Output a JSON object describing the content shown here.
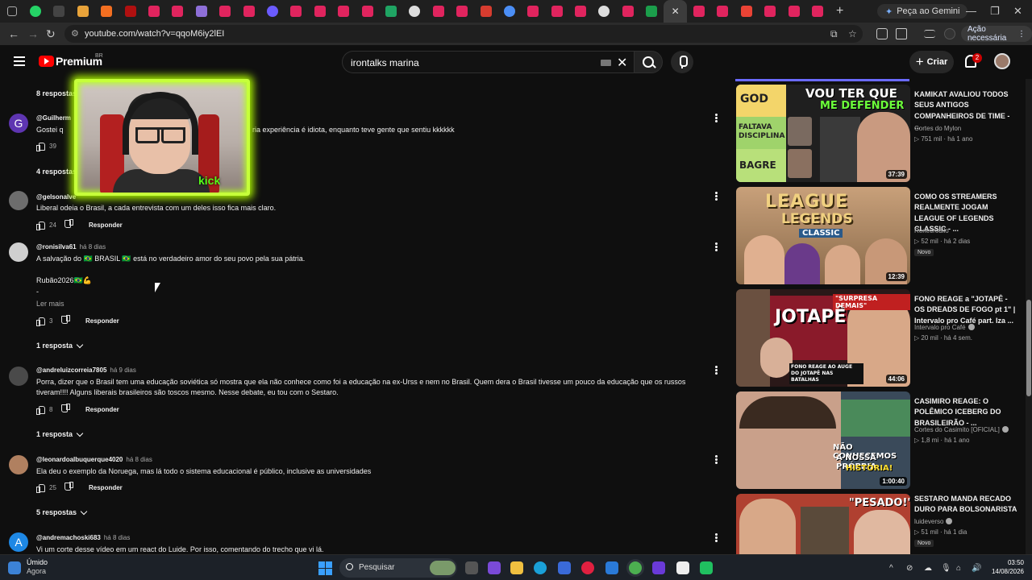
{
  "browser": {
    "url": "youtube.com/watch?v=qqoM6iy2lEI",
    "gemini_label": "Peça ao Gemini",
    "action_label": "Ação necessária"
  },
  "header": {
    "brand": "Premium",
    "country": "BR",
    "search_query": "irontalks marina",
    "create_label": "Criar",
    "notif_count": "2"
  },
  "comments": [
    {
      "type": "replies",
      "label": "8 respostas"
    },
    {
      "author": "@Guilherm",
      "time": "",
      "avatar_letter": "G",
      "avatar_color": "#5e35b1",
      "text_left": "Gostei q",
      "text_right": "ria experiência é idiota, enquanto teve gente que sentiu kkkkkk",
      "likes": "39",
      "reply": "Responder"
    },
    {
      "type": "replies",
      "label": "4 respostas"
    },
    {
      "author": "@gelsonalve",
      "time": "",
      "text": "Liberal odeia o Brasil, a cada entrevista com um deles isso fica mais claro.",
      "likes": "24",
      "reply": "Responder"
    },
    {
      "author": "@ronisilva61",
      "time": "há 8 dias",
      "text": "A salvação do 🇧🇷 BRASIL 🇧🇷 está no verdadeiro amor do seu povo pela sua pátria.",
      "text2": "Rubão2026🇧🇷💪",
      "text3": "-",
      "more": "Ler mais",
      "likes": "3",
      "reply": "Responder",
      "replies": "1 resposta"
    },
    {
      "author": "@andreluizcorreia7805",
      "time": "há 9 dias",
      "text": "Porra, dizer que o Brasil tem uma educação soviética só mostra que ela não conhece como foi a educação na ex-Urss e nem no Brasil. Quem dera o Brasil tivesse um pouco da educação que os russos",
      "text2": "tiveram!!!! Alguns liberais brasileiros são toscos mesmo. Nesse debate, eu tou com o Sestaro.",
      "likes": "8",
      "reply": "Responder",
      "replies": "1 resposta"
    },
    {
      "author": "@leonardoalbuquerque4020",
      "time": "há 8 dias",
      "text": "Ela deu o exemplo da Noruega, mas lá todo o sistema educacional é público, inclusive as universidades",
      "likes": "25",
      "reply": "Responder",
      "replies": "5 respostas"
    },
    {
      "author": "@andremachoski683",
      "time": "há 8 dias",
      "avatar_letter": "A",
      "avatar_color": "#1e88e5",
      "text": "Vi um corte desse vídeo em um react do Luide. Por isso, comentando do trecho que vi lá."
    }
  ],
  "webcam": {
    "brand": "kick"
  },
  "recommendations": [
    {
      "title": "KAMIKAT AVALIOU TODOS SEUS ANTIGOS COMPANHEIROS DE TIME - ...",
      "channel": "Cortes do Mylon",
      "verified": false,
      "views": "751 mil",
      "age": "há 1 ano",
      "duration": "37:39",
      "badge": "",
      "thumb_text": [
        "GOD",
        "FALTAVA DISCIPLINA",
        "BAGRE",
        "VOU TER QUE",
        "ME DEFENDER"
      ]
    },
    {
      "title": "COMO OS STREAMERS REALMENTE JOGAM LEAGUE OF LEGENDS CLASSIC - ...",
      "channel": "Renecrodilo",
      "verified": false,
      "views": "52 mil",
      "age": "há 2 dias",
      "duration": "12:39",
      "badge": "Novo",
      "thumb_text": [
        "LEAGUE",
        "LEGENDS",
        "CLASSIC"
      ]
    },
    {
      "title": "FONO REAGE a \"JOTAPÊ - OS DREADS DE FOGO pt 1\" | Intervalo pro Café part. Iza ...",
      "channel": "Intervalo pro Café",
      "verified": true,
      "views": "20 mil",
      "age": "há 4 sem.",
      "duration": "44:06",
      "badge": "",
      "thumb_text": [
        "\"SURPRESA DEMAIS\"",
        "JOTAPÊ",
        "FONO REAGE AO AUGE DO JOTAPÊ NAS BATALHAS"
      ]
    },
    {
      "title": "CASIMIRO REAGE: O POLÊMICO ICEBERG DO BRASILEIRÃO - ...",
      "channel": "Cortes do Casimito [OFICIAL]",
      "verified": true,
      "views": "1,8 mi",
      "age": "há 1 ano",
      "duration": "1:00:40",
      "badge": "",
      "thumb_text": [
        "NÃO CONHECEMOS",
        "A NOSSA PRÓPRIA",
        "HISTÓRIA!"
      ]
    },
    {
      "title": "SESTARO MANDA RECADO DURO PARA BOLSONARISTA",
      "channel": "luideverso",
      "verified": true,
      "views": "51 mil",
      "age": "há 1 dia",
      "duration": "",
      "badge": "Novo",
      "thumb_text": [
        "\"PESADO!\""
      ]
    }
  ],
  "taskbar": {
    "weather_title": "Úmido",
    "weather_sub": "Agora",
    "search_label": "Pesquisar",
    "time": "03:50",
    "date": "14/08/2026"
  }
}
